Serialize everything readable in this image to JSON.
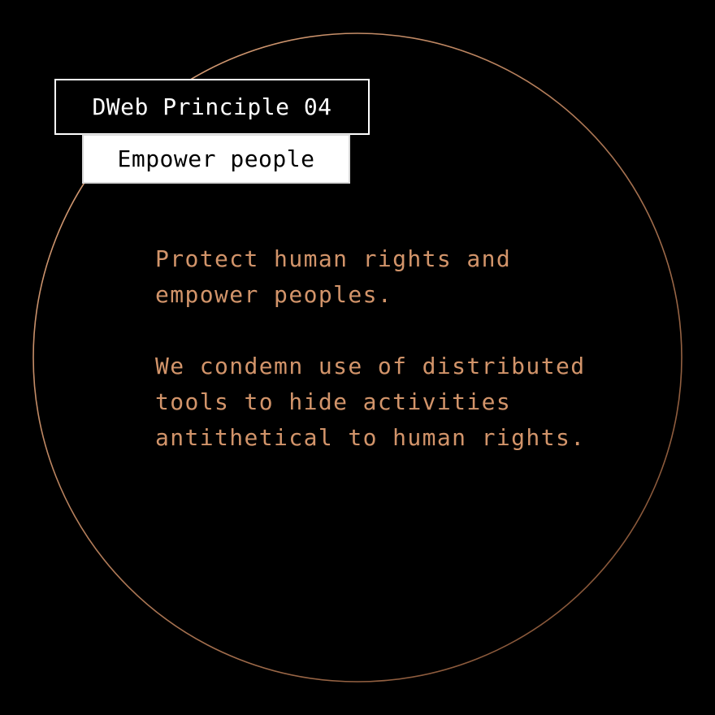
{
  "colors": {
    "background": "#000000",
    "accent": "#d2946a",
    "ring_start": "#e0a57c",
    "ring_end": "#7a4a2e",
    "title_text": "#ffffff",
    "subtitle_bg": "#ffffff"
  },
  "principle": {
    "title": "DWeb Principle 04",
    "subtitle": "Empower people"
  },
  "body": {
    "paragraph_1": [
      "Protect human rights and",
      "empower peoples."
    ],
    "paragraph_2": [
      "We condemn use of distributed",
      "tools to hide activities",
      "antithetical to human rights."
    ]
  }
}
